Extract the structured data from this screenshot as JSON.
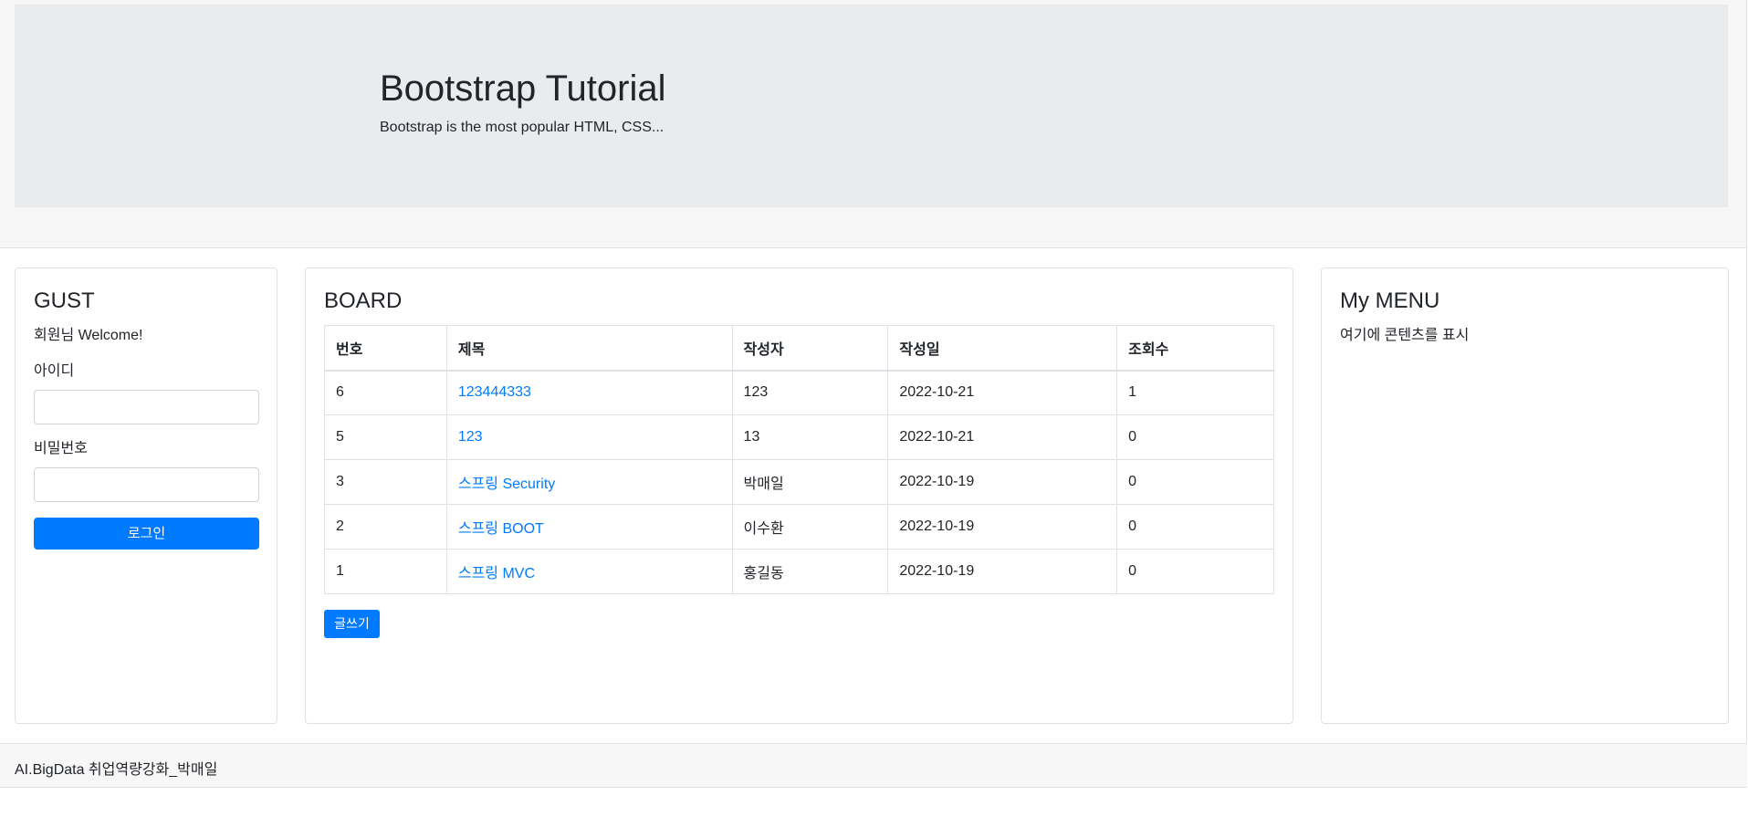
{
  "jumbotron": {
    "title": "Bootstrap Tutorial",
    "subtitle": "Bootstrap is the most popular HTML, CSS..."
  },
  "login_panel": {
    "title": "GUST",
    "welcome": "회원님 Welcome!",
    "id_label": "아이디",
    "id_value": "",
    "password_label": "비밀번호",
    "password_value": "",
    "login_button": "로그인"
  },
  "board": {
    "title": "BOARD",
    "columns": [
      "번호",
      "제목",
      "작성자",
      "작성일",
      "조회수"
    ],
    "rows": [
      [
        "6",
        "123444333",
        "123",
        "2022-10-21",
        "1"
      ],
      [
        "5",
        "123",
        "13",
        "2022-10-21",
        "0"
      ],
      [
        "3",
        "스프링 Security",
        "박매일",
        "2022-10-19",
        "0"
      ],
      [
        "2",
        "스프링 BOOT",
        "이수환",
        "2022-10-19",
        "0"
      ],
      [
        "1",
        "스프링 MVC",
        "홍길동",
        "2022-10-19",
        "0"
      ]
    ],
    "write_button": "글쓰기"
  },
  "menu_panel": {
    "title": "My MENU",
    "text": "여기에 콘텐츠를 표시"
  },
  "footer": {
    "text": "AI.BigData 취업역량강화_박매일"
  },
  "colors": {
    "primary": "#007bff",
    "jumbotron_bg": "#e9ecef",
    "band_bg": "#f7f7f7",
    "border": "#dee2e6"
  }
}
